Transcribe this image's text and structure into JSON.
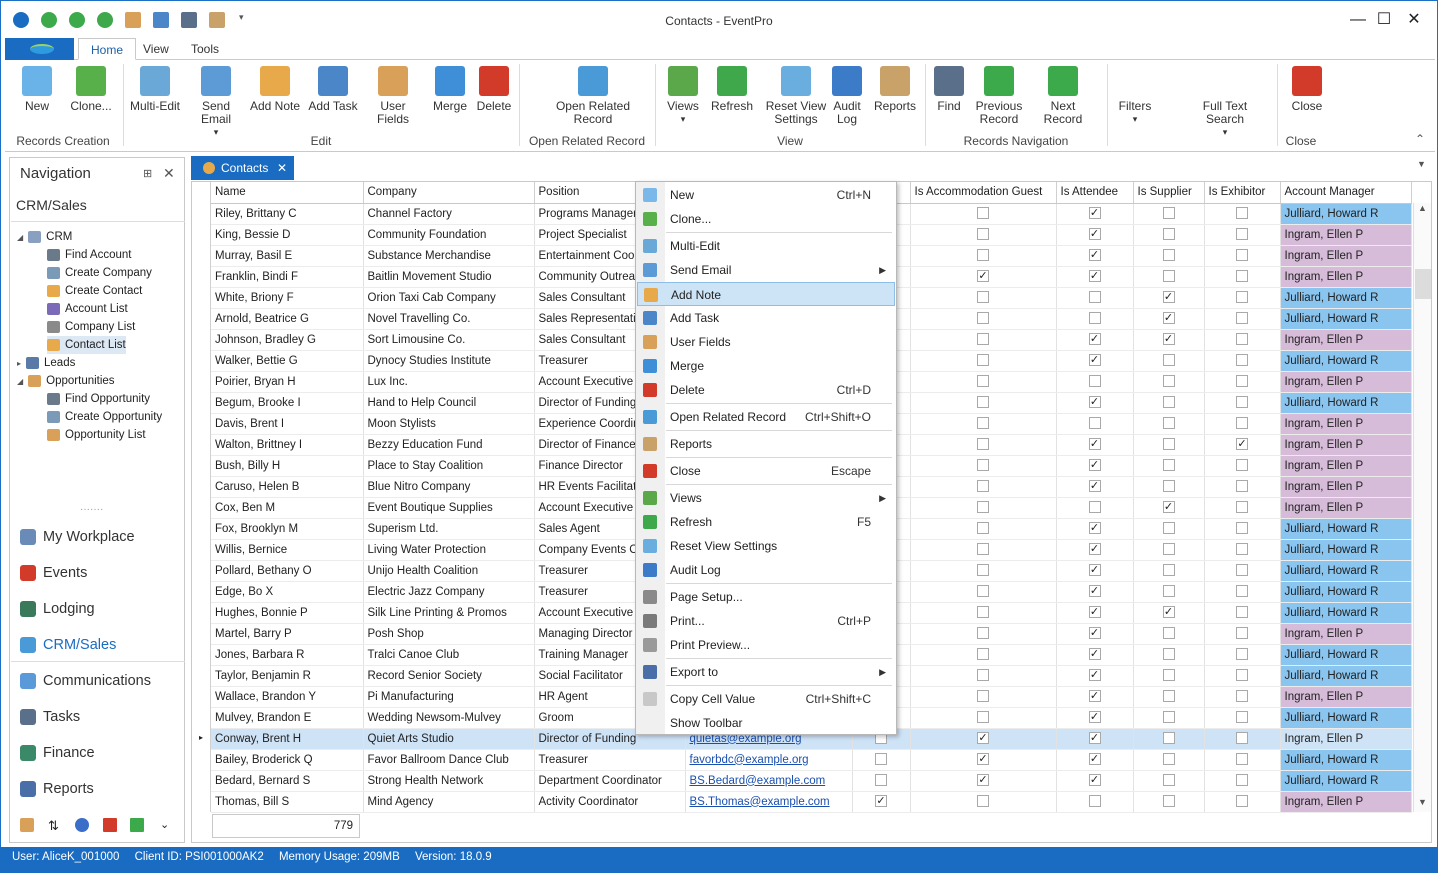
{
  "window": {
    "title": "Contacts - EventPro",
    "min": "—",
    "max": "☐",
    "close": "✕"
  },
  "ribbon_tabs": [
    "Home",
    "View",
    "Tools"
  ],
  "ribbon": {
    "buttons": [
      {
        "label": "New",
        "color": "#6ab3e8"
      },
      {
        "label": "Clone...",
        "color": "#57b04a"
      },
      {
        "label": "Multi-Edit",
        "color": "#6aa8d8"
      },
      {
        "label": "Send Email",
        "color": "#5c9bd6"
      },
      {
        "label": "Add Note",
        "color": "#e8a94a"
      },
      {
        "label": "Add Task",
        "color": "#4a86c8"
      },
      {
        "label": "User Fields",
        "color": "#d9a05a"
      },
      {
        "label": "Merge",
        "color": "#3f8fd8"
      },
      {
        "label": "Delete",
        "color": "#d23a2a"
      },
      {
        "label": "Open Related Record",
        "color": "#4a9ad8"
      },
      {
        "label": "Views",
        "color": "#5aa84a"
      },
      {
        "label": "Refresh",
        "color": "#3ea84a"
      },
      {
        "label": "Reset View Settings",
        "color": "#6aaee0"
      },
      {
        "label": "Audit Log",
        "color": "#3c7bc8"
      },
      {
        "label": "Reports",
        "color": "#c9a26a"
      },
      {
        "label": "Find",
        "color": "#5a6f8a"
      },
      {
        "label": "Previous Record",
        "color": "#3caa4a"
      },
      {
        "label": "Next Record",
        "color": "#3caa4a"
      },
      {
        "label": "Filters",
        "color": "#ffffff"
      },
      {
        "label": "Full Text Search",
        "color": "#ffffff"
      },
      {
        "label": "Close",
        "color": "#d23a2a"
      }
    ],
    "groups": [
      "Records Creation",
      "Edit",
      "Open Related Record",
      "View",
      "Records Navigation",
      "Close"
    ]
  },
  "nav": {
    "title": "Navigation",
    "section": "CRM/Sales",
    "tree": [
      "CRM",
      "Find Account",
      "Create Company",
      "Create Contact",
      "Account List",
      "Company List",
      "Contact List",
      "Leads",
      "Opportunities",
      "Find Opportunity",
      "Create Opportunity",
      "Opportunity List"
    ],
    "items": [
      "My Workplace",
      "Events",
      "Lodging",
      "CRM/Sales",
      "Communications",
      "Tasks",
      "Finance",
      "Reports"
    ],
    "selected_item": "CRM/Sales"
  },
  "doc_tab": "Contacts",
  "grid": {
    "columns": [
      "Name",
      "Company",
      "Position",
      "",
      "",
      "Is Accommodation Guest",
      "Is Attendee",
      "Is Supplier",
      "Is Exhibitor",
      "Account Manager"
    ],
    "rows": [
      [
        "Riley, Brittany C",
        "Channel Factory",
        "Programs Manager",
        "",
        "",
        0,
        1,
        0,
        0,
        "Julliard, Howard R"
      ],
      [
        "King, Bessie D",
        "Community Foundation",
        "Project Specialist",
        "",
        "",
        0,
        1,
        0,
        0,
        "Ingram, Ellen P"
      ],
      [
        "Murray, Basil E",
        "Substance Merchandise",
        "Entertainment Coord",
        "",
        "",
        0,
        1,
        0,
        0,
        "Ingram, Ellen P"
      ],
      [
        "Franklin, Bindi F",
        "Baitlin Movement Studio",
        "Community Outreach",
        "",
        "",
        1,
        1,
        0,
        0,
        "Ingram, Ellen P"
      ],
      [
        "White, Briony F",
        "Orion Taxi Cab Company",
        "Sales Consultant",
        "",
        "",
        0,
        0,
        1,
        0,
        "Julliard, Howard R"
      ],
      [
        "Arnold, Beatrice G",
        "Novel Travelling Co.",
        "Sales Representative",
        "",
        "",
        0,
        0,
        1,
        0,
        "Julliard, Howard R"
      ],
      [
        "Johnson, Bradley G",
        "Sort Limousine Co.",
        "Sales Consultant",
        "",
        "",
        0,
        1,
        1,
        0,
        "Ingram, Ellen P"
      ],
      [
        "Walker, Bettie G",
        "Dynocy Studies Institute",
        "Treasurer",
        "",
        "",
        0,
        1,
        0,
        0,
        "Julliard, Howard R"
      ],
      [
        "Poirier, Bryan H",
        "Lux Inc.",
        "Account Executive",
        "",
        "",
        0,
        0,
        0,
        0,
        "Ingram, Ellen P"
      ],
      [
        "Begum, Brooke I",
        "Hand to Help Council",
        "Director of Funding",
        "",
        "",
        0,
        1,
        0,
        0,
        "Julliard, Howard R"
      ],
      [
        "Davis, Brent I",
        "Moon Stylists",
        "Experience Coordina",
        "",
        "",
        0,
        0,
        0,
        0,
        "Ingram, Ellen P"
      ],
      [
        "Walton, Brittney I",
        "Bezzy Education Fund",
        "Director of Finance",
        "",
        "",
        0,
        1,
        0,
        1,
        "Ingram, Ellen P"
      ],
      [
        "Bush, Billy H",
        "Place to Stay Coalition",
        "Finance Director",
        "",
        "",
        0,
        1,
        0,
        0,
        "Ingram, Ellen P"
      ],
      [
        "Caruso, Helen B",
        "Blue Nitro Company",
        "HR Events Facilitator",
        "",
        "",
        0,
        1,
        0,
        0,
        "Ingram, Ellen P"
      ],
      [
        "Cox, Ben M",
        "Event Boutique Supplies",
        "Account Executive",
        "",
        "",
        0,
        0,
        1,
        0,
        "Ingram, Ellen P"
      ],
      [
        "Fox, Brooklyn M",
        "Superism Ltd.",
        "Sales Agent",
        "",
        "",
        0,
        1,
        0,
        0,
        "Julliard, Howard R"
      ],
      [
        "Willis, Bernice",
        "Living Water Protection",
        "Company Events Co",
        "",
        "",
        0,
        1,
        0,
        0,
        "Julliard, Howard R"
      ],
      [
        "Pollard, Bethany O",
        "Unijo Health Coalition",
        "Treasurer",
        "",
        "",
        0,
        1,
        0,
        0,
        "Julliard, Howard R"
      ],
      [
        "Edge, Bo X",
        "Electric Jazz Company",
        "Treasurer",
        "",
        "",
        0,
        1,
        0,
        0,
        "Julliard, Howard R"
      ],
      [
        "Hughes, Bonnie P",
        "Silk Line Printing & Promos",
        "Account Executive",
        "",
        "",
        0,
        1,
        1,
        0,
        "Julliard, Howard R"
      ],
      [
        "Martel, Barry P",
        "Posh Shop",
        "Managing Director",
        "",
        "",
        0,
        1,
        0,
        0,
        "Ingram, Ellen P"
      ],
      [
        "Jones, Barbara R",
        "Tralci Canoe Club",
        "Training Manager",
        "",
        "",
        0,
        1,
        0,
        0,
        "Julliard, Howard R"
      ],
      [
        "Taylor, Benjamin R",
        "Record Senior Society",
        "Social Facilitator",
        "",
        "",
        0,
        1,
        0,
        0,
        "Julliard, Howard R"
      ],
      [
        "Wallace, Brandon Y",
        "Pi Manufacturing",
        "HR Agent",
        "",
        "",
        0,
        1,
        0,
        0,
        "Ingram, Ellen P"
      ],
      [
        "Mulvey, Brandon E",
        "Wedding Newsom-Mulvey",
        "Groom",
        "",
        "",
        0,
        1,
        0,
        0,
        "Julliard, Howard R"
      ],
      [
        "Conway, Brent H",
        "Quiet Arts Studio",
        "Director of Funding",
        "quietas@example.org",
        "0",
        1,
        1,
        0,
        0,
        "Ingram, Ellen P"
      ],
      [
        "Bailey, Broderick Q",
        "Favor Ballroom Dance Club",
        "Treasurer",
        "favorbdc@example.org",
        "0",
        1,
        1,
        0,
        0,
        "Julliard, Howard R"
      ],
      [
        "Bedard, Bernard S",
        "Strong Health Network",
        "Department Coordinator",
        "BS.Bedard@example.com",
        "0",
        1,
        1,
        0,
        0,
        "Julliard, Howard R"
      ],
      [
        "Thomas, Bill S",
        "Mind Agency",
        "Activity Coordinator",
        "BS.Thomas@example.com",
        "1",
        0,
        0,
        0,
        0,
        "Ingram, Ellen P"
      ]
    ],
    "current_row": 25,
    "count": "779"
  },
  "menu": [
    {
      "label": "New",
      "key": "Ctrl+N",
      "color": "#7ab8ea"
    },
    {
      "label": "Clone...",
      "key": "",
      "color": "#57b04a"
    },
    {
      "sep": true
    },
    {
      "label": "Multi-Edit",
      "key": "",
      "color": "#6aa8d8"
    },
    {
      "label": "Send Email",
      "key": "",
      "sub": true,
      "color": "#5c9bd6"
    },
    {
      "label": "Add Note",
      "key": "",
      "hl": true,
      "color": "#e8a94a"
    },
    {
      "label": "Add Task",
      "key": "",
      "color": "#4a86c8"
    },
    {
      "label": "User Fields",
      "key": "",
      "color": "#d9a05a"
    },
    {
      "label": "Merge",
      "key": "",
      "color": "#3f8fd8"
    },
    {
      "label": "Delete",
      "key": "Ctrl+D",
      "color": "#d23a2a"
    },
    {
      "sep": true
    },
    {
      "label": "Open Related Record",
      "key": "Ctrl+Shift+O",
      "color": "#4a9ad8"
    },
    {
      "sep": true
    },
    {
      "label": "Reports",
      "key": "",
      "color": "#c9a26a"
    },
    {
      "sep": true
    },
    {
      "label": "Close",
      "key": "Escape",
      "color": "#d23a2a"
    },
    {
      "sep": true
    },
    {
      "label": "Views",
      "key": "",
      "sub": true,
      "color": "#5aa84a"
    },
    {
      "label": "Refresh",
      "key": "F5",
      "color": "#3ea84a"
    },
    {
      "label": "Reset View Settings",
      "key": "",
      "color": "#6aaee0"
    },
    {
      "label": "Audit Log",
      "key": "",
      "color": "#3c7bc8"
    },
    {
      "sep": true
    },
    {
      "label": "Page Setup...",
      "key": "",
      "color": "#8a8a8a"
    },
    {
      "label": "Print...",
      "key": "Ctrl+P",
      "color": "#7a7a7a"
    },
    {
      "label": "Print Preview...",
      "key": "",
      "color": "#9a9a9a"
    },
    {
      "sep": true
    },
    {
      "label": "Export to",
      "key": "",
      "sub": true,
      "color": "#4a6fa8"
    },
    {
      "sep": true
    },
    {
      "label": "Copy Cell Value",
      "key": "Ctrl+Shift+C",
      "color": "#c8c8c8"
    },
    {
      "label": "Show Toolbar",
      "key": "",
      "color": "#f0f0f0"
    }
  ],
  "status": {
    "user": "User: AliceK_001000",
    "client": "Client ID: PSI001000AK2",
    "memory": "Memory Usage: 209MB",
    "version": "Version: 18.0.9"
  },
  "colors": {
    "accent": "#1a6cc2",
    "manager_julliard": "#8ac5ef",
    "manager_ingram": "#d6bcd8"
  }
}
